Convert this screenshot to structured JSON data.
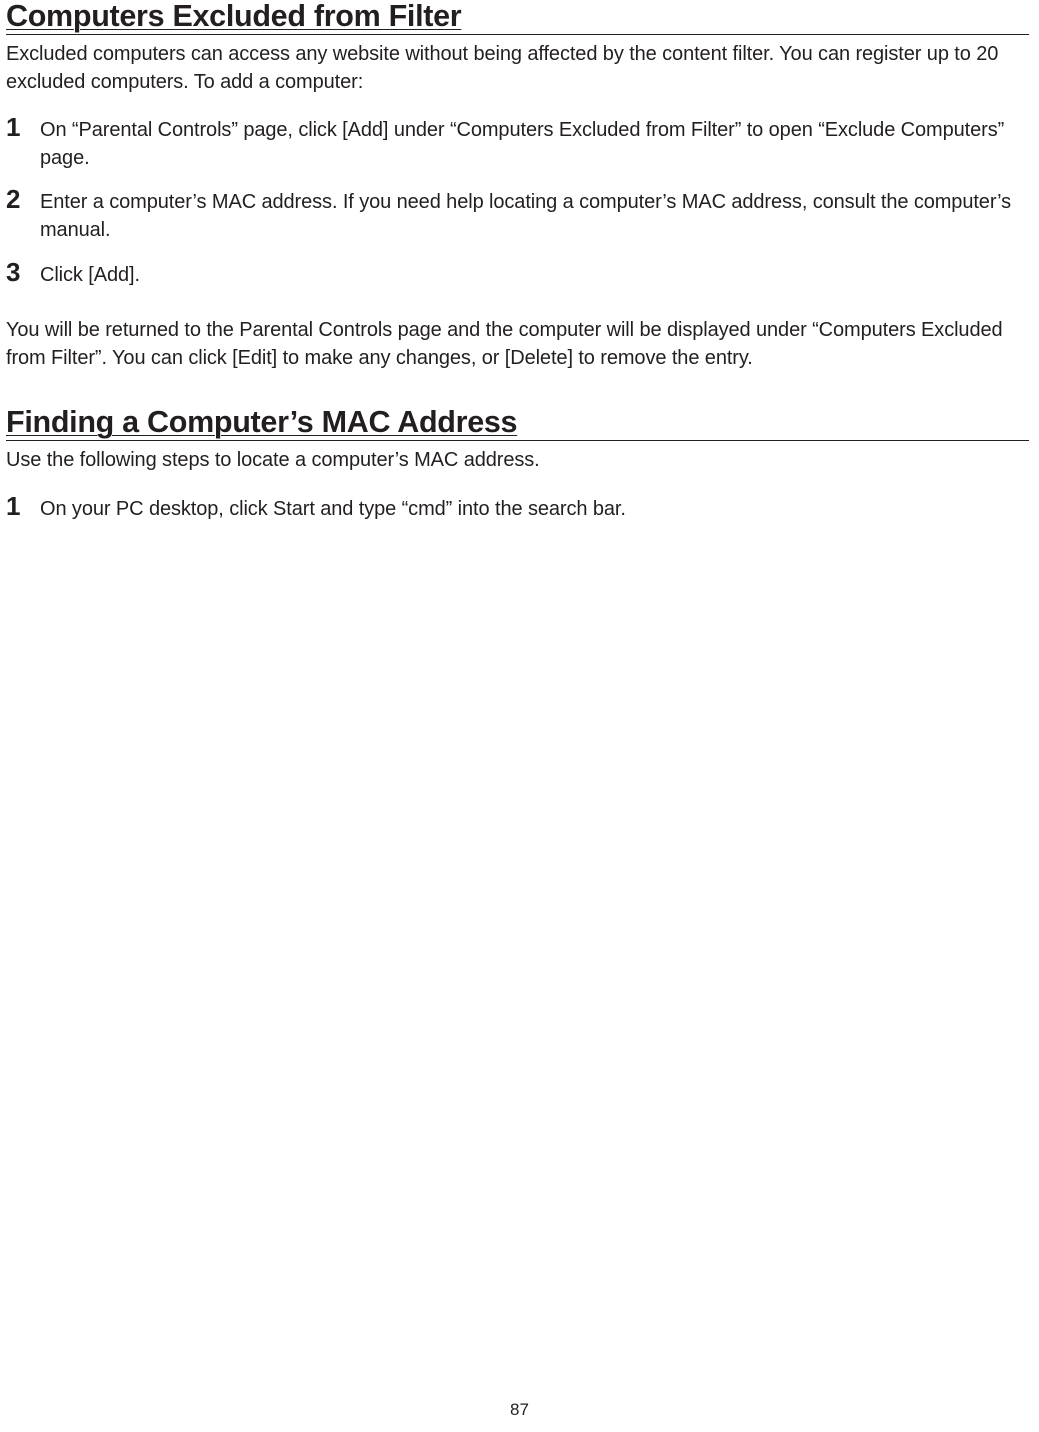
{
  "section1": {
    "heading": "Computers Excluded from Filter",
    "intro": "Excluded computers can access any website without being affected by the content filter. You can register up to 20 excluded computers. To add a computer:",
    "steps": [
      {
        "num": "1",
        "text": "On “Parental Controls” page, click [Add] under “Computers Excluded from Filter” to open “Exclude Computers” page."
      },
      {
        "num": "2",
        "text": "Enter a computer’s MAC address. If you need help locating a computer’s MAC address, consult the computer’s manual."
      },
      {
        "num": "3",
        "text": "Click [Add]."
      }
    ],
    "after": "You will be returned to the Parental Controls page and the computer will be displayed under “Computers Excluded from Filter”. You can click [Edit] to make any changes, or [Delete] to remove the entry."
  },
  "section2": {
    "heading": "Finding a Computer’s MAC Address",
    "intro": "Use the following steps to locate a computer’s MAC address.",
    "steps": [
      {
        "num": "1",
        "text": "On your PC desktop, click Start and type “cmd” into the search bar."
      }
    ]
  },
  "page_number": "87"
}
